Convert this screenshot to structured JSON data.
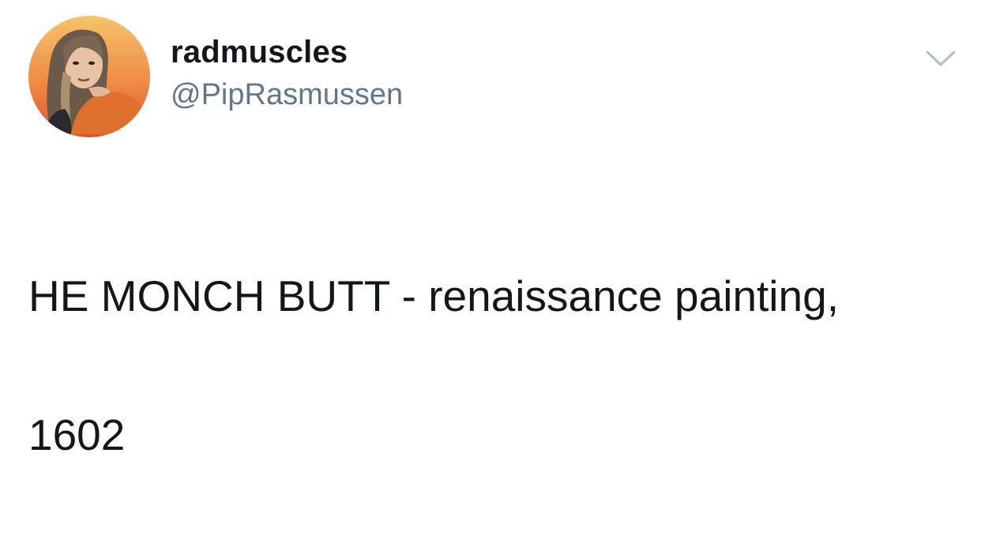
{
  "tweet": {
    "author": {
      "display_name": "radmuscles",
      "handle": "@PipRasmussen",
      "avatar_icon": "profile-photo"
    },
    "text_line1": "HE MONCH BUTT - renaissance painting,",
    "text_line2": "1602",
    "menu_icon": "chevron-down-icon"
  },
  "colors": {
    "primary_text": "#14171a",
    "secondary_text": "#657786",
    "caret": "#b5bec6",
    "avatar_bg_top": "#f4b45c",
    "avatar_bg_bottom": "#e2623a"
  }
}
